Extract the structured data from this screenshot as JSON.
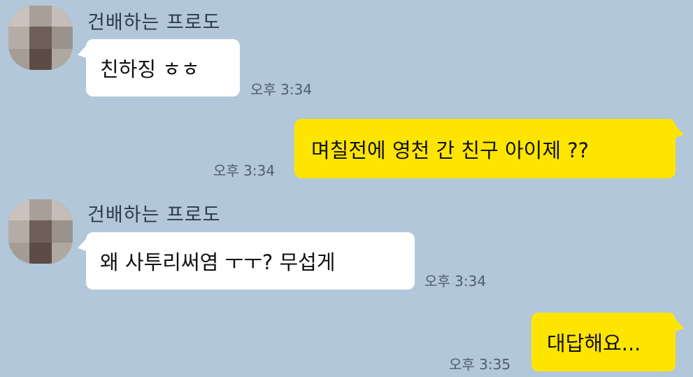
{
  "colors": {
    "background": "#b2c7da",
    "received_bubble": "#ffffff",
    "sent_bubble": "#fee500"
  },
  "messages": [
    {
      "direction": "received",
      "sender": "건배하는 프로도",
      "text": "친하징 ㅎㅎ",
      "time": "오후 3:34"
    },
    {
      "direction": "sent",
      "text": "며칠전에 영천 간 친구 아이제 ??",
      "time": "오후 3:34"
    },
    {
      "direction": "received",
      "sender": "건배하는 프로도",
      "text": "왜 사투리써염 ㅜㅜ? 무섭게",
      "time": "오후 3:34"
    },
    {
      "direction": "sent",
      "text": "대답해요...",
      "time": "오후 3:35"
    }
  ],
  "icons": {
    "avatar": "blurred-profile-avatar"
  }
}
